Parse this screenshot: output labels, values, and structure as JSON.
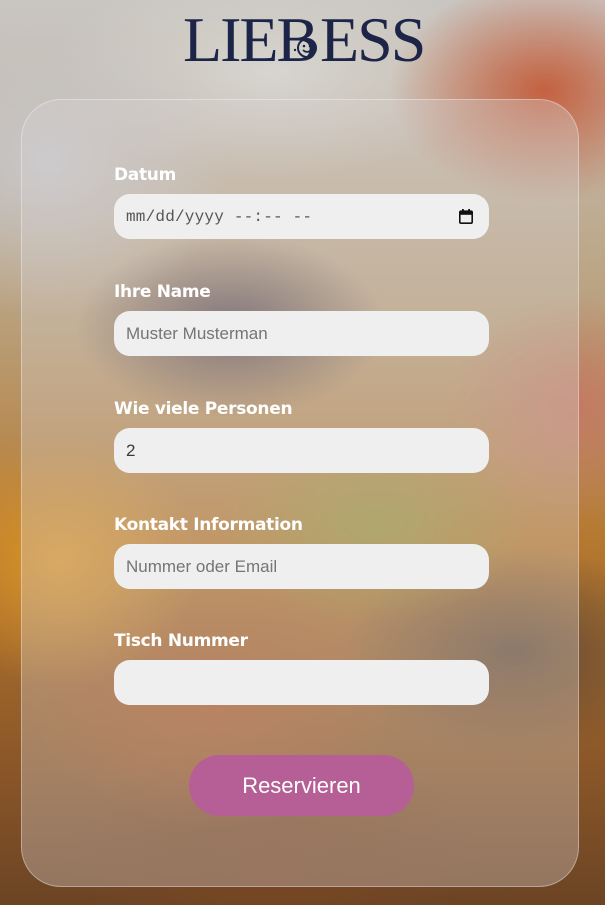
{
  "brand": {
    "logo_text": "LIEB ESS",
    "logo_left": "LIEB",
    "logo_right": "ESS",
    "logo_color": "#1c2548"
  },
  "form": {
    "fields": [
      {
        "label": "Datum",
        "type": "datetime-local",
        "placeholder": "mm/dd/yyyy --:-- --",
        "value": ""
      },
      {
        "label": "Ihre Name",
        "type": "text",
        "placeholder": "Muster Musterman",
        "value": ""
      },
      {
        "label": "Wie viele Personen",
        "type": "number",
        "placeholder": "",
        "value": "2"
      },
      {
        "label": "Kontakt Information",
        "type": "text",
        "placeholder": "Nummer oder Email",
        "value": ""
      },
      {
        "label": "Tisch Nummer",
        "type": "text",
        "placeholder": "",
        "value": ""
      }
    ],
    "submit_label": "Reservieren"
  },
  "icons": {
    "date_picker": "calendar-icon",
    "logo_mark": "smiley-plate-icon"
  },
  "colors": {
    "button": "#b55f96",
    "input_background": "#efefef",
    "label_text": "#ffffff"
  }
}
